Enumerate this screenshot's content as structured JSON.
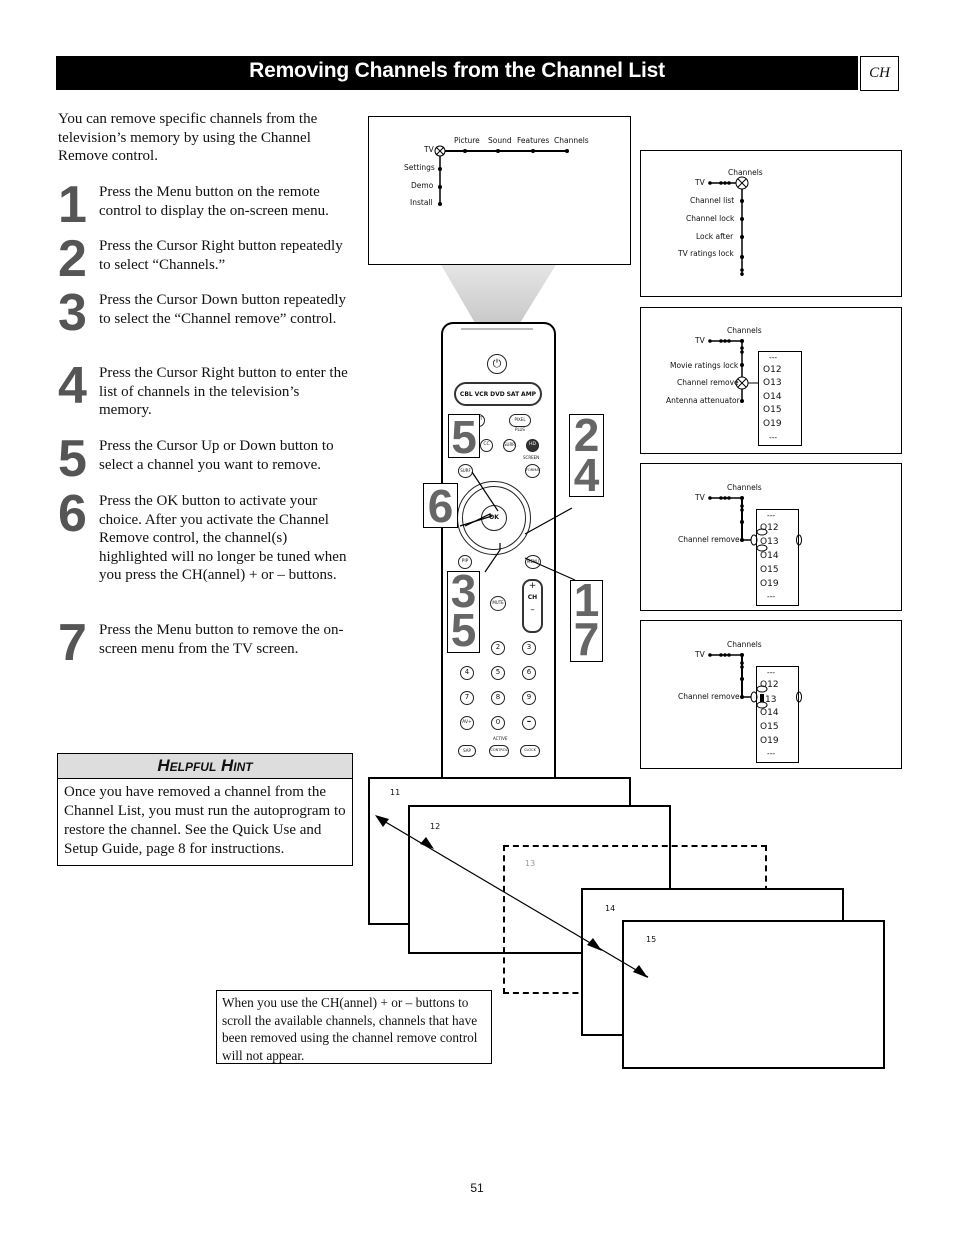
{
  "header": {
    "title": "Removing Channels from the Channel List",
    "section_tag": "CH"
  },
  "intro": "You can remove specific channels from the television’s memory by using the Channel Remove control.",
  "steps": [
    {
      "num": "1",
      "text": "Press the Menu button on the remote control to display the on-screen menu."
    },
    {
      "num": "2",
      "text": "Press the Cursor Right button repeatedly to select “Channels.”"
    },
    {
      "num": "3",
      "text": "Press the Cursor Down button repeatedly to select the “Channel remove” control."
    },
    {
      "num": "4",
      "text": "Press the Cursor Right button to enter the list of channels in the television’s memory."
    },
    {
      "num": "5",
      "text": "Press the Cursor Up or Down button to select a channel you want to remove."
    },
    {
      "num": "6",
      "text": "Press the OK button to activate your choice. After you activate the Channel Remove control, the channel(s) highlighted will no longer be tuned when you press the CH(annel) + or – buttons."
    },
    {
      "num": "7",
      "text": "Press the Menu button to remove the on-screen menu from the TV screen."
    }
  ],
  "hint": {
    "title": "Helpful Hint",
    "text": "Once you have removed a channel from the Channel List, you must run the autoprogram to restore the channel.  See the Quick Use and Setup Guide, page 8 for instructions."
  },
  "screen_main_menu": {
    "root": "TV",
    "top_items": [
      "Picture",
      "Sound",
      "Features",
      "Channels"
    ],
    "side_items": [
      "Settings",
      "Demo",
      "Install"
    ]
  },
  "screen_channels": {
    "root": "TV",
    "menu": "Channels",
    "items": [
      "Channel list",
      "Channel lock",
      "Lock after",
      "TV ratings lock"
    ]
  },
  "screen_channel_remove": {
    "root": "TV",
    "menu": "Channels",
    "items": [
      "Movie ratings lock",
      "Channel remove",
      "Antenna attenuator"
    ],
    "list_top": "---",
    "channels": [
      "12",
      "13",
      "14",
      "15",
      "19"
    ],
    "list_bottom": "---"
  },
  "screen_select": {
    "root": "TV",
    "menu": "Channels",
    "item": "Channel remove",
    "list_top": "---",
    "channels": [
      "12",
      "13",
      "14",
      "15",
      "19"
    ],
    "list_bottom": "---",
    "selected": "13"
  },
  "screen_activated": {
    "root": "TV",
    "menu": "Channels",
    "item": "Channel remove",
    "list_top": "---",
    "channels": [
      "12",
      "13",
      "14",
      "15",
      "19"
    ],
    "list_bottom": "---",
    "removed": "13"
  },
  "remote": {
    "source_buttons": [
      "CBL",
      "VCR",
      "DVD",
      "SAT",
      "AMP"
    ],
    "buttons": {
      "select": "SELECT",
      "pixelplus": "PIXEL PLUS",
      "cc": "CC",
      "surr": "SURR",
      "hd": "HD",
      "surf": "SURF",
      "screen_label": "SCREEN",
      "format": "FORMAT",
      "ok": "OK",
      "pip": "PIP",
      "menu": "MENU",
      "mute": "MUTE",
      "ch": "CH",
      "ch_plus": "+",
      "ch_minus": "–",
      "digits": [
        "2",
        "3",
        "4",
        "5",
        "6",
        "7",
        "8",
        "9"
      ],
      "zero": "0",
      "avplus": "AV+",
      "dash": "–",
      "active_label": "ACTIVE",
      "sap": "SAP",
      "control": "CONTROL",
      "clock": "CLOCK"
    },
    "callouts": [
      {
        "id": "c5",
        "text": "5"
      },
      {
        "id": "c24",
        "text": "2\n4"
      },
      {
        "id": "c6",
        "text": "6"
      },
      {
        "id": "c35",
        "text": "3\n5"
      },
      {
        "id": "c17",
        "text": "1\n7"
      }
    ]
  },
  "scroll_frames": [
    "11",
    "12",
    "13",
    "14",
    "15"
  ],
  "note": "When you use the CH(annel) + or – buttons to scroll the available channels, channels that have been removed using the channel remove control will not appear.",
  "page_number": "51"
}
